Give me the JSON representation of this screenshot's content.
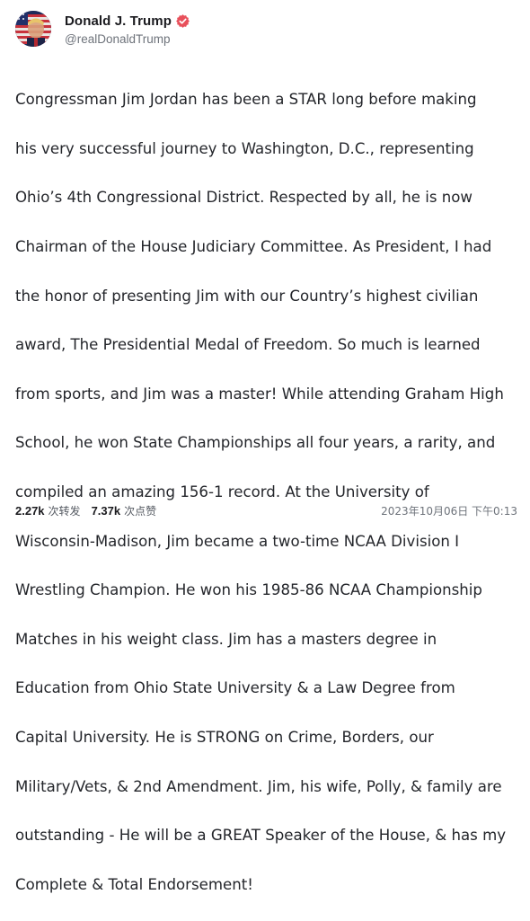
{
  "author": {
    "display_name": "Donald J. Trump",
    "handle": "@realDonaldTrump",
    "verified_color": "#e8505b",
    "avatar_icon": "flag-portrait-avatar"
  },
  "post": {
    "lines": [
      "Congressman Jim Jordan has been a STAR long before making",
      "his very successful journey to Washington, D.C., representing",
      "Ohio’s 4th Congressional District. Respected by all, he is now",
      "Chairman of the House Judiciary Committee. As President, I had",
      "the honor of presenting Jim with our Country’s highest civilian",
      "award, The Presidential Medal of Freedom. So much is learned",
      "from sports, and Jim was a master! While attending Graham High",
      "School, he won State Championships all four years, a rarity, and",
      "compiled an amazing 156-1 record. At the University of",
      "Wisconsin-Madison, Jim became a two-time NCAA Division I",
      "Wrestling Champion. He won his 1985-86 NCAA Championship",
      "Matches in his weight class. Jim has a masters degree in",
      "Education from Ohio State University & a Law Degree from",
      "Capital University. He is STRONG on Crime, Borders, our",
      "Military/Vets, & 2nd Amendment. Jim, his wife, Polly, & family are",
      "outstanding - He will be a GREAT Speaker of the House, & has my",
      "Complete & Total Endorsement!"
    ]
  },
  "stats": {
    "reposts_value": "2.27k",
    "reposts_label": "次转发",
    "likes_value": "7.37k",
    "likes_label": "次点赞"
  },
  "timestamp": "2023年10月06日 下午0:13"
}
